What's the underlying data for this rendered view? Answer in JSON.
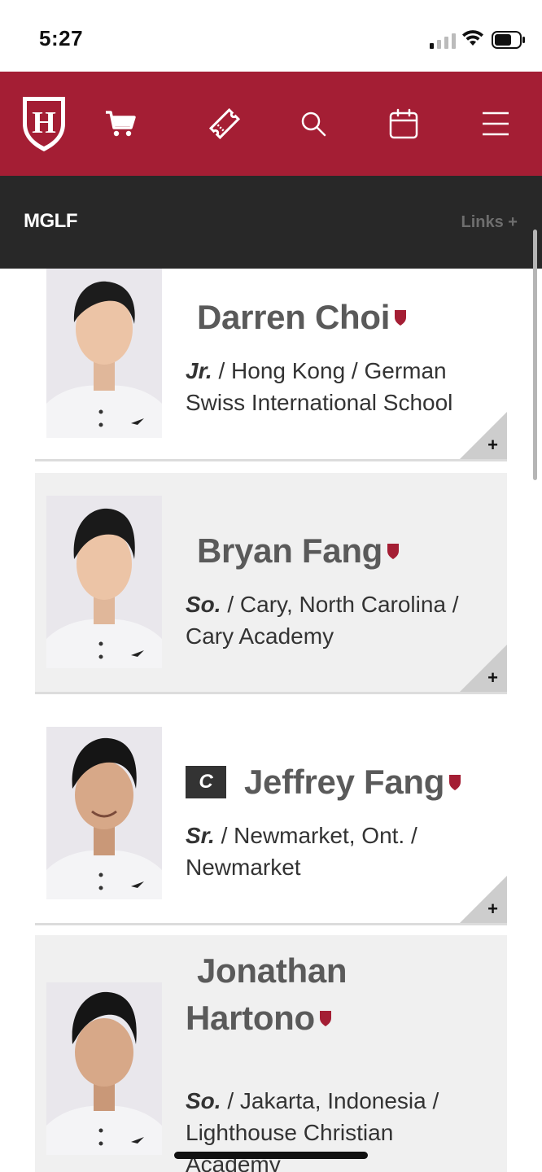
{
  "status_bar": {
    "time": "5:27"
  },
  "nav": {
    "logo_letter": "H",
    "icons": [
      "shield-logo-icon",
      "cart-icon",
      "ticket-icon",
      "search-icon",
      "calendar-icon",
      "hamburger-menu-icon"
    ]
  },
  "section": {
    "title": "MGLF",
    "links_label": "Links +"
  },
  "colors": {
    "brand_crimson": "#a41e34",
    "section_bar": "#282828",
    "name_gray": "#5a5a5a"
  },
  "roster": [
    {
      "name_first": "Darren Choi",
      "name_last": "",
      "captain": "",
      "year": "Jr.",
      "bio": " / Hong Kong / German Swiss International School",
      "expand": "+"
    },
    {
      "name_first": "Bryan Fang",
      "name_last": "",
      "captain": "",
      "year": "So.",
      "bio": " / Cary, North Carolina / Cary Academy",
      "expand": "+"
    },
    {
      "name_first": "Jeffrey Fang",
      "name_last": "",
      "captain": "C",
      "year": "Sr.",
      "bio": " / Newmarket, Ont. / Newmarket",
      "expand": "+"
    },
    {
      "name_first": "Jonathan",
      "name_last": "Hartono",
      "captain": "",
      "year": "So.",
      "bio": " / Jakarta, Indonesia / Lighthouse Christian Academy",
      "expand": "+"
    }
  ]
}
